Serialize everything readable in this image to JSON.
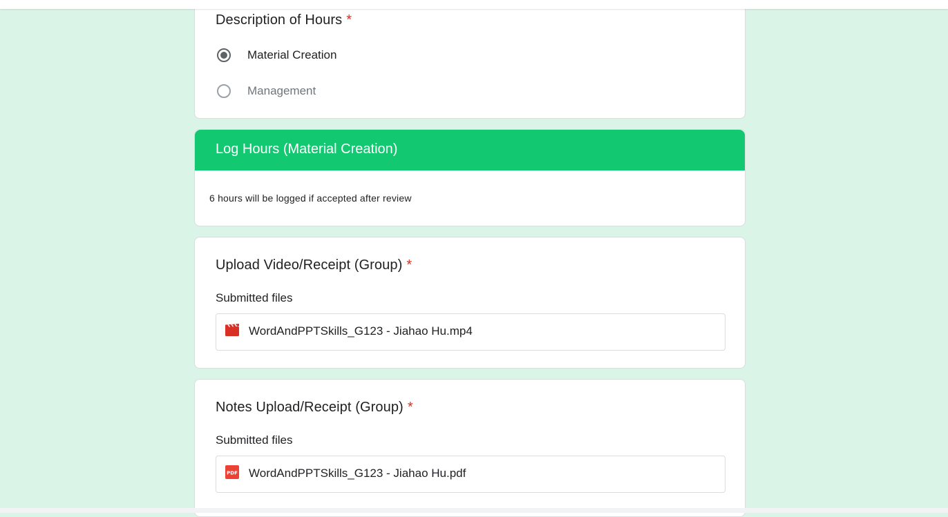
{
  "colors": {
    "page_background": "#daf5e7",
    "section_header": "#12c971",
    "required_mark": "#d93025",
    "video_icon": "#d93025",
    "pdf_icon": "#ea4335"
  },
  "description_question": {
    "title": "Description of Hours",
    "required_mark": "*",
    "options": [
      {
        "label": "Material Creation",
        "selected": true
      },
      {
        "label": "Management",
        "selected": false
      }
    ]
  },
  "log_section": {
    "title": "Log Hours (Material Creation)",
    "description": "6 hours will be logged if accepted after review"
  },
  "video_upload": {
    "title": "Upload Video/Receipt (Group)",
    "required_mark": "*",
    "submitted_label": "Submitted files",
    "file": {
      "name": "WordAndPPTSkills_G123 - Jiahao Hu.mp4",
      "icon": "video-file-icon"
    }
  },
  "notes_upload": {
    "title": "Notes Upload/Receipt (Group)",
    "required_mark": "*",
    "submitted_label": "Submitted files",
    "file": {
      "name": "WordAndPPTSkills_G123 - Jiahao Hu.pdf",
      "icon": "pdf-file-icon",
      "icon_text": "PDF"
    }
  }
}
